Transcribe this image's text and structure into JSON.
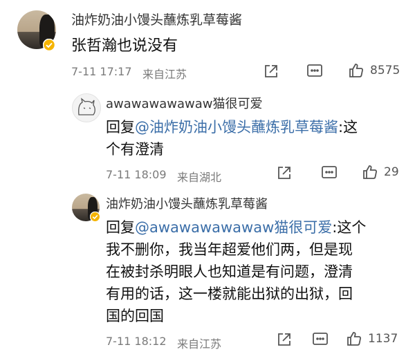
{
  "comments": [
    {
      "username": "油炸奶油小馒头蘸炼乳草莓酱",
      "text": "张哲瀚也说没有",
      "time": "7-11 17:17",
      "location": "来自江苏",
      "likes": "8575"
    },
    {
      "username": "awawawawawaw猫很可爱",
      "reply_prefix": "回复",
      "mention": "@油炸奶油小馒头蘸炼乳草莓酱",
      "line1_rest": ":这",
      "line2": "个有澄清",
      "time": "7-11 18:09",
      "location": "来自湖北",
      "likes": "29"
    },
    {
      "username": "油炸奶油小馒头蘸炼乳草莓酱",
      "reply_prefix": "回复",
      "mention": "@awawawawawaw猫很可爱",
      "line1_rest": ":这个",
      "line2": "我不删你，我当年超爱他们两，但是现",
      "line3": "在被封杀明眼人也知道是有问题，澄清",
      "line4": "有用的话，这一楼就能出狱的出狱，回",
      "line5": "国的回国",
      "time": "7-11 18:12",
      "location": "来自江苏",
      "likes": "1137"
    }
  ],
  "colors": {
    "mention": "#3b6ea8",
    "verified": "#f5b400",
    "meta": "#7a7a7a"
  },
  "icons": [
    "share-icon",
    "comment-icon",
    "like-icon",
    "verified-badge-icon"
  ]
}
